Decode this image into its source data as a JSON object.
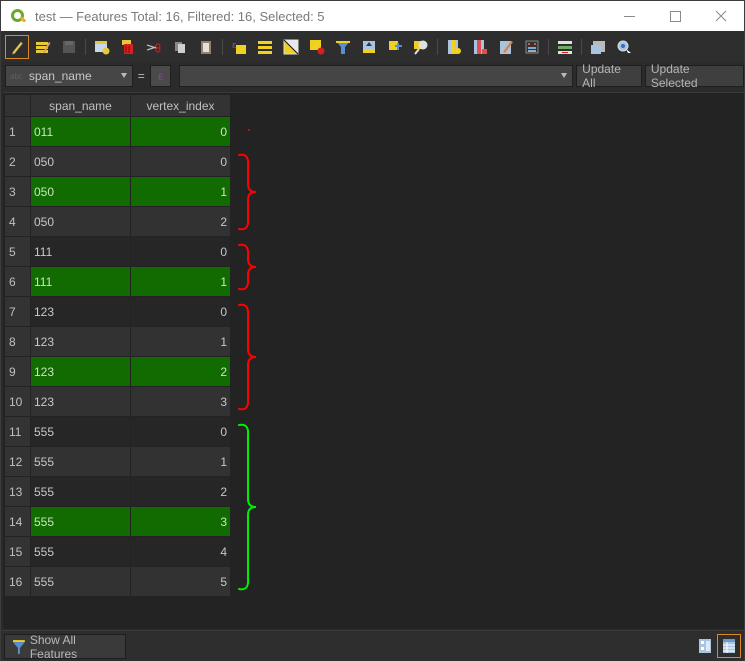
{
  "window": {
    "title": "test — Features Total: 16, Filtered: 16, Selected: 5",
    "controls": [
      "minimize",
      "maximize",
      "close"
    ]
  },
  "toolbar": {
    "buttons": [
      {
        "name": "toggle-editing",
        "icon": "pencil-icon",
        "active": true
      },
      {
        "name": "toggle-multi-edit",
        "icon": "multi-edit-icon"
      },
      {
        "name": "save-edits",
        "icon": "save-icon",
        "disabled": true
      },
      {
        "name": "add-feature",
        "icon": "add-feature-icon"
      },
      {
        "name": "delete-selected",
        "icon": "delete-icon"
      },
      {
        "name": "cut-features",
        "icon": "scissors-icon"
      },
      {
        "name": "copy-features",
        "icon": "copy-icon"
      },
      {
        "name": "paste-features",
        "icon": "paste-icon"
      },
      {
        "name": "select-by-expression",
        "icon": "select-expression-icon"
      },
      {
        "name": "select-all",
        "icon": "select-all-icon"
      },
      {
        "name": "invert-selection",
        "icon": "invert-selection-icon"
      },
      {
        "name": "deselect-all",
        "icon": "deselect-icon"
      },
      {
        "name": "filter-select",
        "icon": "filter-icon"
      },
      {
        "name": "move-selection-to-top",
        "icon": "move-top-icon"
      },
      {
        "name": "pan-to-selected",
        "icon": "pan-icon"
      },
      {
        "name": "zoom-to-selected",
        "icon": "zoom-icon"
      },
      {
        "name": "new-field",
        "icon": "new-field-icon"
      },
      {
        "name": "delete-field",
        "icon": "delete-field-icon"
      },
      {
        "name": "field-calculator",
        "icon": "field-calc-icon"
      },
      {
        "name": "conditional-formatting",
        "icon": "conditional-format-icon"
      },
      {
        "name": "actions",
        "icon": "actions-icon"
      },
      {
        "name": "dock-table",
        "icon": "dock-icon"
      },
      {
        "name": "identify",
        "icon": "identify-icon"
      }
    ]
  },
  "calcbar": {
    "field_type": "abc",
    "field": "span_name",
    "equals": "=",
    "expression": "",
    "expr_button": "ε",
    "update_all": "Update All",
    "update_selected": "Update Selected"
  },
  "table": {
    "columns": [
      "span_name",
      "vertex_index"
    ],
    "rows": [
      {
        "n": "1",
        "span_name": "011",
        "vertex_index": "0",
        "selected": true
      },
      {
        "n": "2",
        "span_name": "050",
        "vertex_index": "0",
        "selected": false
      },
      {
        "n": "3",
        "span_name": "050",
        "vertex_index": "1",
        "selected": true
      },
      {
        "n": "4",
        "span_name": "050",
        "vertex_index": "2",
        "selected": false
      },
      {
        "n": "5",
        "span_name": "111",
        "vertex_index": "0",
        "selected": false
      },
      {
        "n": "6",
        "span_name": "111",
        "vertex_index": "1",
        "selected": true
      },
      {
        "n": "7",
        "span_name": "123",
        "vertex_index": "0",
        "selected": false
      },
      {
        "n": "8",
        "span_name": "123",
        "vertex_index": "1",
        "selected": false
      },
      {
        "n": "9",
        "span_name": "123",
        "vertex_index": "2",
        "selected": true
      },
      {
        "n": "10",
        "span_name": "123",
        "vertex_index": "3",
        "selected": false
      },
      {
        "n": "11",
        "span_name": "555",
        "vertex_index": "0",
        "selected": false
      },
      {
        "n": "12",
        "span_name": "555",
        "vertex_index": "1",
        "selected": false
      },
      {
        "n": "13",
        "span_name": "555",
        "vertex_index": "2",
        "selected": false
      },
      {
        "n": "14",
        "span_name": "555",
        "vertex_index": "3",
        "selected": true
      },
      {
        "n": "15",
        "span_name": "555",
        "vertex_index": "4",
        "selected": false
      },
      {
        "n": "16",
        "span_name": "555",
        "vertex_index": "5",
        "selected": false
      }
    ]
  },
  "annotations": {
    "colors": {
      "red": "#ff0000",
      "green": "#00ee00"
    },
    "groups": [
      {
        "color": "red",
        "rows": [
          1,
          1
        ],
        "shape": "dot"
      },
      {
        "color": "red",
        "rows": [
          2,
          4
        ],
        "shape": "brace"
      },
      {
        "color": "red",
        "rows": [
          5,
          6
        ],
        "shape": "brace"
      },
      {
        "color": "red",
        "rows": [
          7,
          10
        ],
        "shape": "brace"
      },
      {
        "color": "green",
        "rows": [
          11,
          16
        ],
        "shape": "brace"
      }
    ]
  },
  "bottombar": {
    "show_features": "Show All Features",
    "views": [
      {
        "name": "form-view",
        "active": false
      },
      {
        "name": "table-view",
        "active": true
      }
    ]
  },
  "colors": {
    "selection": "#116b00",
    "active_border": "#d98a23"
  }
}
